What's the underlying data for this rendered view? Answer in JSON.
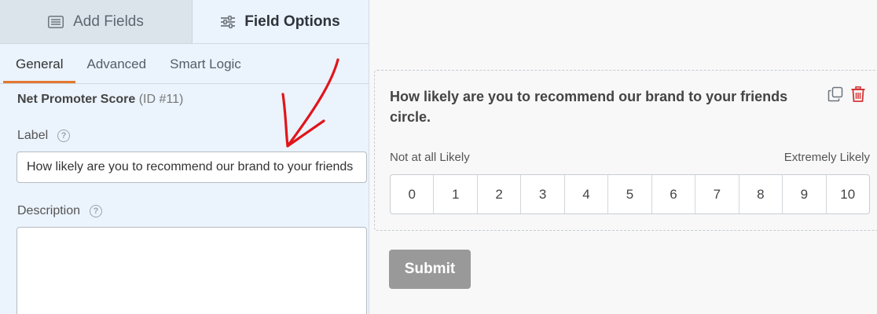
{
  "tabs": {
    "add_fields": "Add Fields",
    "field_options": "Field Options",
    "active": "Field Options"
  },
  "subtabs": [
    {
      "label": "General",
      "active": true
    },
    {
      "label": "Advanced",
      "active": false
    },
    {
      "label": "Smart Logic",
      "active": false
    }
  ],
  "field": {
    "name": "Net Promoter Score",
    "id_text": "(ID #11)"
  },
  "options": {
    "label_caption": "Label",
    "label_value": "How likely are you to recommend our brand to your friends circle.",
    "description_caption": "Description",
    "description_value": "",
    "help_glyph": "?"
  },
  "preview": {
    "question": "How likely are you to recommend our brand to your friends circle.",
    "low_label": "Not at all Likely",
    "high_label": "Extremely Likely",
    "scale": [
      "0",
      "1",
      "2",
      "3",
      "4",
      "5",
      "6",
      "7",
      "8",
      "9",
      "10"
    ],
    "submit_label": "Submit"
  },
  "icons": {
    "add_fields": "list-icon",
    "field_options": "sliders-icon",
    "duplicate": "duplicate-icon",
    "delete": "trash-icon",
    "annotation": "red-arrow-annotation"
  },
  "colors": {
    "accent_tab": "#e27730",
    "delete_icon": "#d63638",
    "arrow": "#e0151b",
    "submit_bg": "#999999",
    "panel_bg": "#ebf3fc"
  }
}
